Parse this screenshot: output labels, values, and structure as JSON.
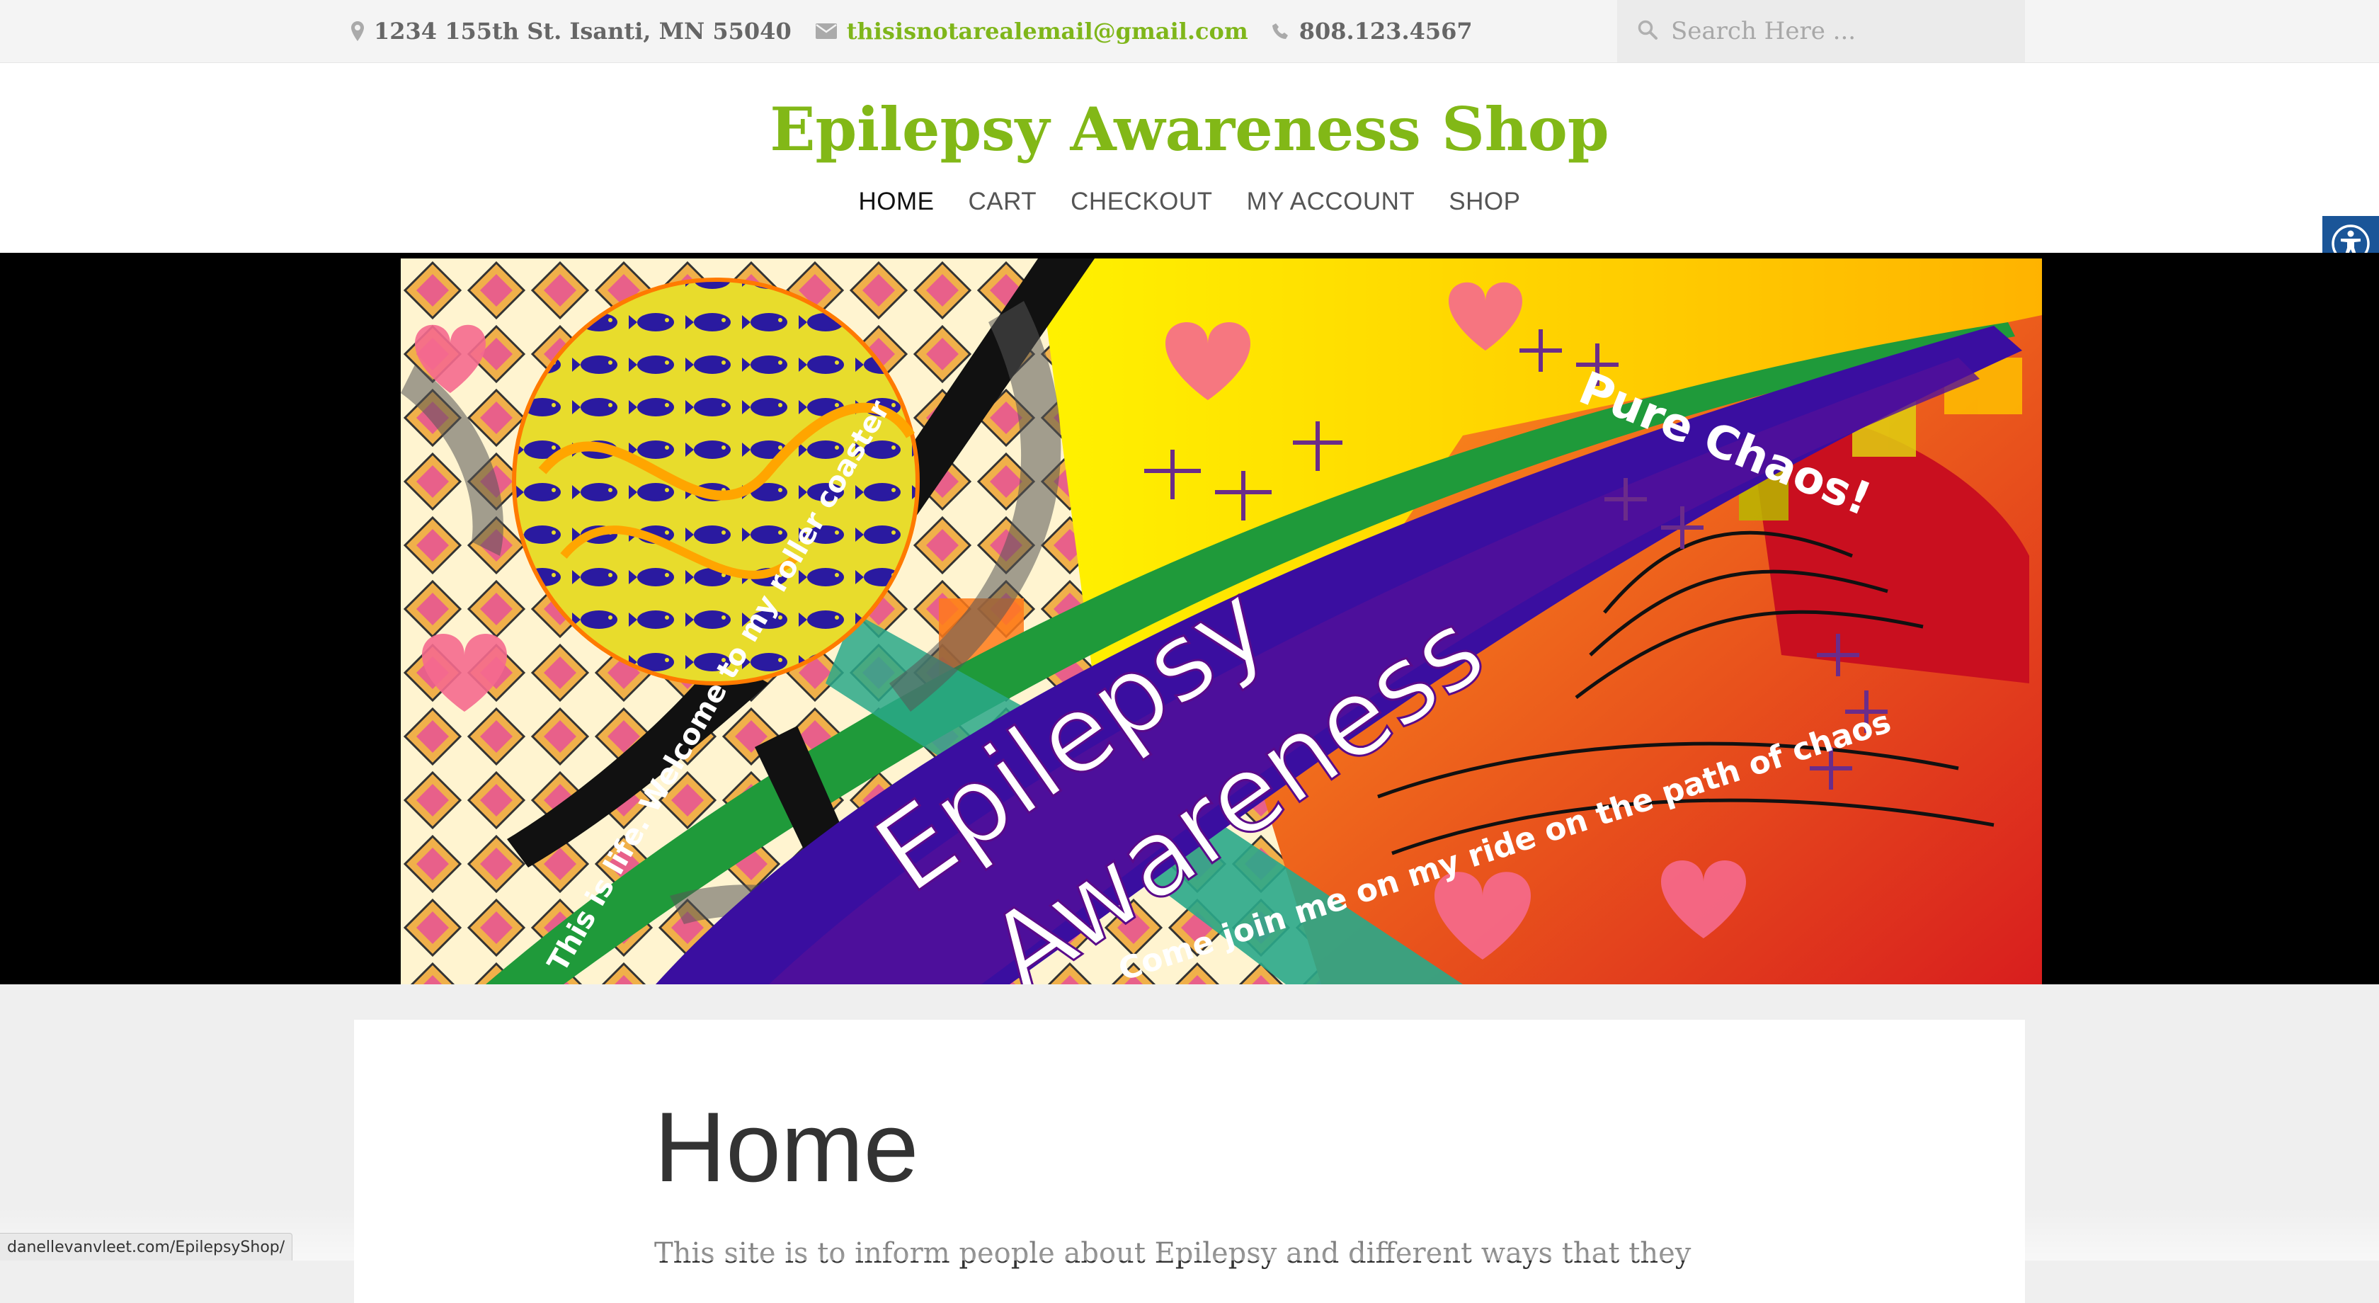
{
  "topbar": {
    "address": "1234 155th St. Isanti, MN 55040",
    "email": "thisisnotarealemail@gmail.com",
    "phone": "808.123.4567",
    "search_placeholder": "Search Here ...",
    "icons": [
      "map-marker-icon",
      "envelope-icon",
      "phone-icon",
      "search-icon"
    ]
  },
  "header": {
    "site_title": "Epilepsy Awareness Shop",
    "nav": [
      {
        "label": "HOME",
        "active": true
      },
      {
        "label": "CART",
        "active": false
      },
      {
        "label": "CHECKOUT",
        "active": false
      },
      {
        "label": "MY ACCOUNT",
        "active": false
      },
      {
        "label": "SHOP",
        "active": false
      }
    ]
  },
  "banner": {
    "headline_1": "Epilepsy",
    "headline_2": "Awareness",
    "tagline_1": "Pure Chaos!",
    "tagline_2": "Come join me on my ride on the path of chaos",
    "tagline_3": "This is life. Welcome to my roller coaster"
  },
  "content": {
    "page_title": "Home",
    "intro": "This site is to inform people about Epilepsy and different ways that they"
  },
  "status_url": "danellevanvleet.com/EpilepsyShop/",
  "colors": {
    "brand_green": "#82b817",
    "accessibility_blue": "#1a5598"
  }
}
